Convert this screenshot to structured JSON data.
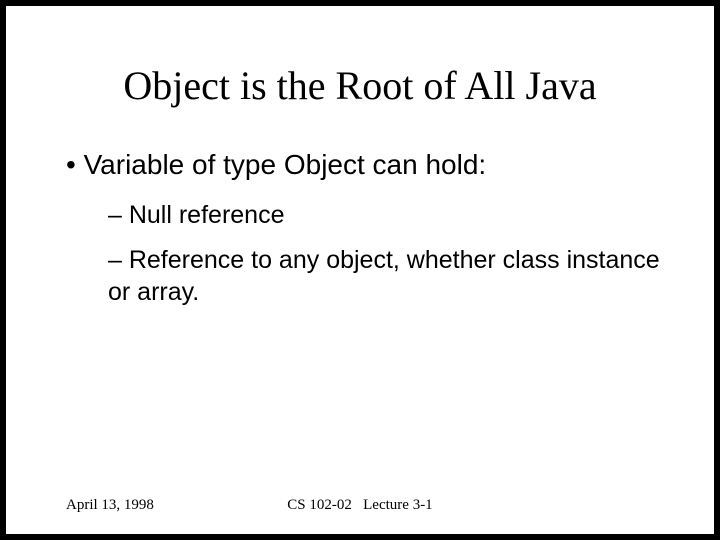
{
  "slide": {
    "title": "Object is the Root of All Java",
    "bullets": {
      "main": "• Variable of type Object can hold:",
      "sub1": "– Null reference",
      "sub2": "– Reference to any object, whether class instance or array."
    },
    "footer": {
      "date": "April 13, 1998",
      "course": "CS 102-02",
      "lecture": "Lecture 3-1"
    }
  }
}
